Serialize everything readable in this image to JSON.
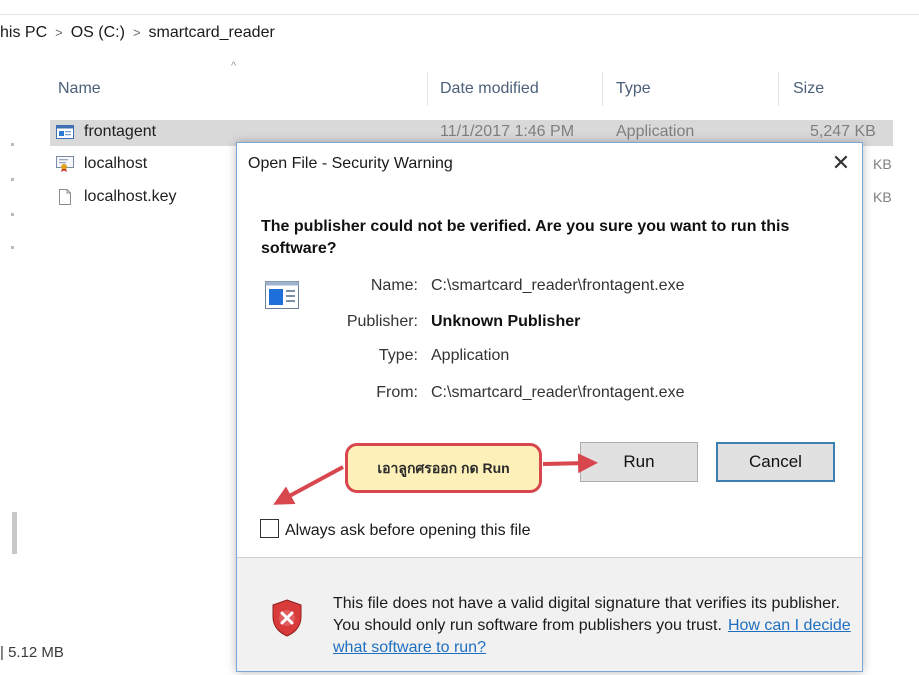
{
  "explorer": {
    "breadcrumb": [
      "his PC",
      "OS (C:)",
      "smartcard_reader"
    ],
    "breadcrumb_separator": ">",
    "columns": [
      "Name",
      "Date modified",
      "Type",
      "Size"
    ],
    "files": [
      {
        "name": "frontagent",
        "date": "11/1/2017 1:46 PM",
        "type": "Application",
        "size": "5,247 KB",
        "icon": "application-icon",
        "selected": true
      },
      {
        "name": "localhost",
        "size_tail": "KB",
        "icon": "certificate-icon"
      },
      {
        "name": "localhost.key",
        "size_tail": "KB",
        "icon": "blank-file-icon"
      }
    ],
    "status_text": "| 5.12 MB"
  },
  "dialog": {
    "title": "Open File - Security Warning",
    "close_glyph": "✕",
    "question": "The publisher could not be verified.  Are you sure you want to run this software?",
    "fields": [
      {
        "label": "Name:",
        "value": "C:\\smartcard_reader\\frontagent.exe",
        "bold": false
      },
      {
        "label": "Publisher:",
        "value": "Unknown Publisher",
        "bold": true
      },
      {
        "label": "Type:",
        "value": "Application",
        "bold": false
      },
      {
        "label": "From:",
        "value": "C:\\smartcard_reader\\frontagent.exe",
        "bold": false
      }
    ],
    "run_label": "Run",
    "cancel_label": "Cancel",
    "checkbox_label": "Always ask before opening this file",
    "checkbox_checked": false,
    "warning_text": "This file does not have a valid digital signature that verifies its publisher.  You should only run software from publishers you trust.",
    "warning_link": "How can I decide what software to run?"
  },
  "annotation": {
    "callout_text": "เอาลูกศรออก กด Run",
    "color": "#d8464e"
  },
  "colors": {
    "selection": "#d9d9d9",
    "dialog_border": "#7aa7d6",
    "link": "#1f6fc1",
    "default_button_border": "#3c7fb1"
  }
}
